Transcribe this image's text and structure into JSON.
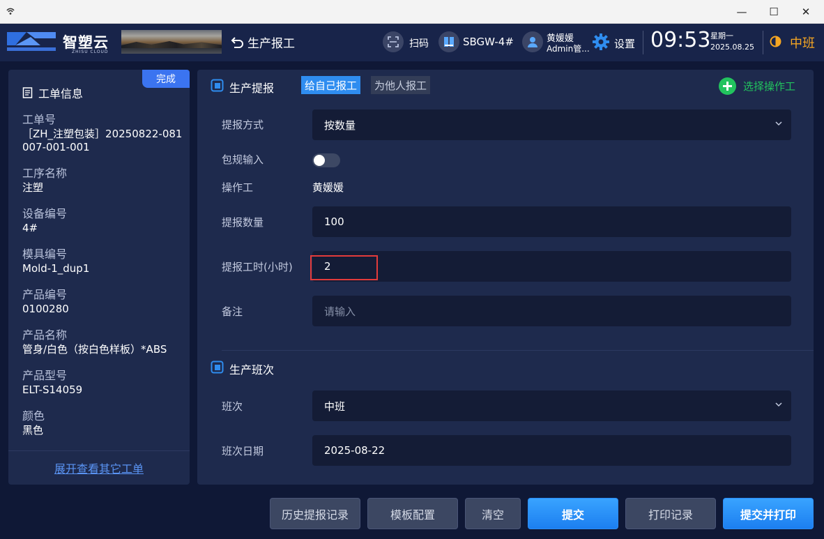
{
  "window": {
    "controls": {
      "minimize": "—",
      "maximize": "☐",
      "close": "✕"
    }
  },
  "header": {
    "logo_text": "智塑云",
    "logo_sub": "ZHISU CLOUD",
    "page_title": "生产报工",
    "scan_label": "扫码",
    "device_label": "SBGW-4#",
    "user_name": "黄媛媛",
    "user_role": "Admin管...",
    "settings_label": "设置",
    "time": "09:53",
    "weekday": "星期一",
    "date": "2025.08.25",
    "shift": "中班",
    "icons": [
      "back-arrow-icon",
      "scan-icon",
      "device-icon",
      "user-icon",
      "gear-icon",
      "half-moon-icon"
    ]
  },
  "left_panel": {
    "badge": "完成",
    "title": "工单信息",
    "items": [
      {
        "label": "工单号",
        "value": "［ZH_注塑包装］20250822-081007-001-001"
      },
      {
        "label": "工序名称",
        "value": "注塑"
      },
      {
        "label": "设备编号",
        "value": "4#"
      },
      {
        "label": "模具编号",
        "value": "Mold-1_dup1"
      },
      {
        "label": "产品编号",
        "value": "0100280"
      },
      {
        "label": "产品名称",
        "value": "管身/白色（按白色样板）*ABS"
      },
      {
        "label": "产品型号",
        "value": "ELT-S14059"
      },
      {
        "label": "颜色",
        "value": "黑色"
      }
    ],
    "expand_link": "展开查看其它工单"
  },
  "report": {
    "section_title": "生产提报",
    "tab_self": "给自己报工",
    "tab_other": "为他人报工",
    "select_operator": "选择操作工",
    "method_label": "提报方式",
    "method_value": "按数量",
    "package_label": "包规输入",
    "package_on": false,
    "operator_label": "操作工",
    "operator_value": "黄媛媛",
    "qty_label": "提报数量",
    "qty_value": "100",
    "hours_label": "提报工时(小时)",
    "hours_value": "2",
    "remark_label": "备注",
    "remark_placeholder": "请输入"
  },
  "shift_section": {
    "title": "生产班次",
    "shift_label": "班次",
    "shift_value": "中班",
    "date_label": "班次日期",
    "date_value": "2025-08-22"
  },
  "actions": {
    "history": "历史提报记录",
    "template": "模板配置",
    "clear": "清空",
    "submit": "提交",
    "print_record": "打印记录",
    "submit_print": "提交并打印"
  },
  "colors": {
    "page_bg": "#0f1836",
    "panel_bg": "#1e2a4d",
    "accent_blue": "#2f8df0",
    "add_green": "#22c35e",
    "shift_orange": "#f5a623",
    "highlight_red": "#e33b3b"
  }
}
